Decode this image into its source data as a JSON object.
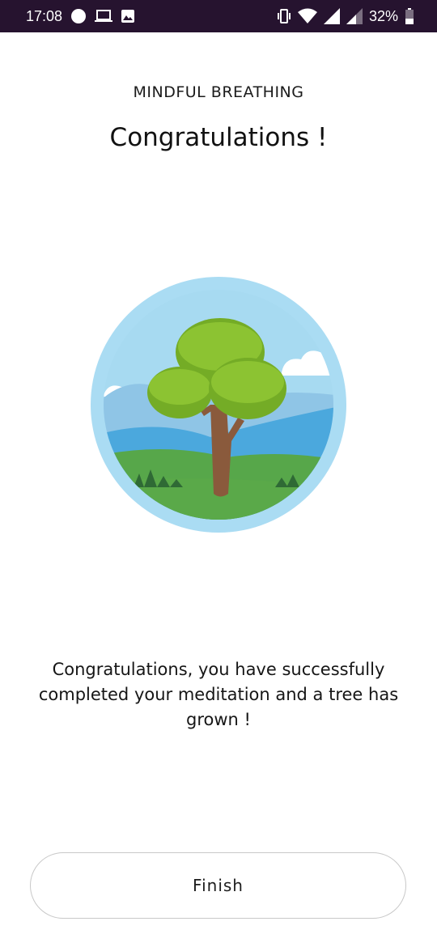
{
  "status_bar": {
    "time": "17:08",
    "battery": "32%",
    "icons": [
      "circle-notification-icon",
      "laptop-icon",
      "image-icon",
      "vibrate-icon",
      "wifi-icon",
      "signal-icon",
      "signal-weak-icon",
      "battery-icon"
    ]
  },
  "screen": {
    "subtitle": "MINDFUL BREATHING",
    "title": "Congratulations !",
    "message": "Congratulations, you have successfully completed your meditation and a tree has grown !",
    "finish_label": "Finish"
  },
  "colors": {
    "status_bar_bg": "#26132f",
    "sky": "#a9dcf2",
    "grass": "#5aa949",
    "leaves": "#86bc2a",
    "trunk": "#8a5a3c"
  }
}
